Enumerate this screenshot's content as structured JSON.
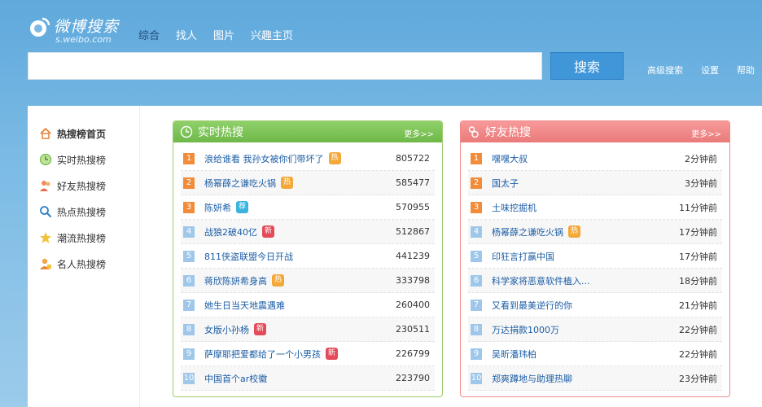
{
  "brand": {
    "name_cn": "微博搜索",
    "name_en": "s.weibo.com"
  },
  "nav": [
    {
      "label": "综合",
      "active": true
    },
    {
      "label": "找人",
      "active": false
    },
    {
      "label": "图片",
      "active": false
    },
    {
      "label": "兴趣主页",
      "active": false
    }
  ],
  "search": {
    "value": "",
    "placeholder": "",
    "button": "搜索"
  },
  "toplinks": [
    "高级搜索",
    "设置",
    "帮助"
  ],
  "sidebar": [
    {
      "label": "热搜榜首页",
      "icon": "home-icon"
    },
    {
      "label": "实时热搜榜",
      "icon": "clock-icon"
    },
    {
      "label": "好友热搜榜",
      "icon": "friends-icon"
    },
    {
      "label": "热点热搜榜",
      "icon": "magnifier-icon"
    },
    {
      "label": "潮流热搜榜",
      "icon": "star-icon"
    },
    {
      "label": "名人热搜榜",
      "icon": "celebrity-icon"
    }
  ],
  "realtime": {
    "title": "实时热搜",
    "more": "更多>>",
    "items": [
      {
        "rank": "1",
        "title": "浪给谁看 我孙女被你们带坏了",
        "tag": "热",
        "tag_type": "hot",
        "value": "805722"
      },
      {
        "rank": "2",
        "title": "杨幂薛之谦吃火锅",
        "tag": "热",
        "tag_type": "hot",
        "value": "585477"
      },
      {
        "rank": "3",
        "title": "陈妍希",
        "tag": "荐",
        "tag_type": "rec",
        "value": "570955"
      },
      {
        "rank": "4",
        "title": "战狼2破40亿",
        "tag": "新",
        "tag_type": "new",
        "value": "512867"
      },
      {
        "rank": "5",
        "title": "811侠盗联盟今日开战",
        "tag": "",
        "tag_type": "",
        "value": "441239"
      },
      {
        "rank": "6",
        "title": "蒋欣陈妍希身高",
        "tag": "热",
        "tag_type": "hot",
        "value": "333798"
      },
      {
        "rank": "7",
        "title": "她生日当天地震遇难",
        "tag": "",
        "tag_type": "",
        "value": "260400"
      },
      {
        "rank": "8",
        "title": "女版小孙杨",
        "tag": "新",
        "tag_type": "new",
        "value": "230511"
      },
      {
        "rank": "9",
        "title": "萨摩耶把爱都给了一个小男孩",
        "tag": "新",
        "tag_type": "new",
        "value": "226799"
      },
      {
        "rank": "10",
        "title": "中国首个ar校徽",
        "tag": "",
        "tag_type": "",
        "value": "223790"
      }
    ]
  },
  "friends": {
    "title": "好友热搜",
    "more": "更多>>",
    "items": [
      {
        "rank": "1",
        "title": "嘿嘿大叔",
        "tag": "",
        "tag_type": "",
        "value": "2分钟前"
      },
      {
        "rank": "2",
        "title": "国太子",
        "tag": "",
        "tag_type": "",
        "value": "3分钟前"
      },
      {
        "rank": "3",
        "title": "土味挖掘机",
        "tag": "",
        "tag_type": "",
        "value": "11分钟前"
      },
      {
        "rank": "4",
        "title": "杨幂薛之谦吃火锅",
        "tag": "热",
        "tag_type": "hot",
        "value": "17分钟前"
      },
      {
        "rank": "5",
        "title": "印狂言打赢中国",
        "tag": "",
        "tag_type": "",
        "value": "17分钟前"
      },
      {
        "rank": "6",
        "title": "科学家将恶意软件植入...",
        "tag": "",
        "tag_type": "",
        "value": "18分钟前"
      },
      {
        "rank": "7",
        "title": "又看到最美逆行的你",
        "tag": "",
        "tag_type": "",
        "value": "21分钟前"
      },
      {
        "rank": "8",
        "title": "万达捐款1000万",
        "tag": "",
        "tag_type": "",
        "value": "22分钟前"
      },
      {
        "rank": "9",
        "title": "吴昕潘玮柏",
        "tag": "",
        "tag_type": "",
        "value": "22分钟前"
      },
      {
        "rank": "10",
        "title": "郑爽蹲地与助理热聊",
        "tag": "",
        "tag_type": "",
        "value": "23分钟前"
      }
    ]
  },
  "colors": {
    "rank_top": "#f28c3b",
    "rank_other": "#9fc7ea",
    "realtime_head": "#7dc259",
    "friends_head": "#f08a8a",
    "search_button": "#3f96d9"
  }
}
